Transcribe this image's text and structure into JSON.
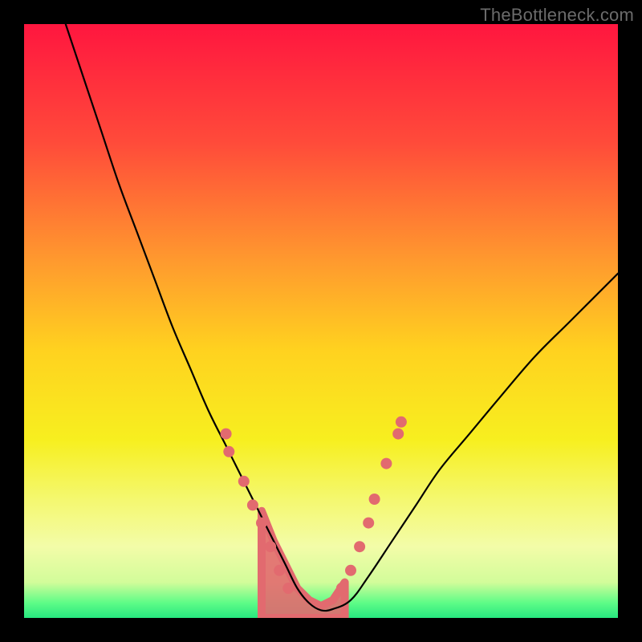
{
  "watermark": "TheBottleneck.com",
  "chart_data": {
    "type": "line",
    "title": "",
    "xlabel": "",
    "ylabel": "",
    "xlim": [
      0,
      100
    ],
    "ylim": [
      0,
      100
    ],
    "grid": false,
    "legend": false,
    "background_gradient": {
      "stops": [
        {
          "offset": 0.0,
          "color": "#ff163f"
        },
        {
          "offset": 0.2,
          "color": "#ff4b3a"
        },
        {
          "offset": 0.4,
          "color": "#ff9a2e"
        },
        {
          "offset": 0.55,
          "color": "#ffd21f"
        },
        {
          "offset": 0.7,
          "color": "#f7ef1f"
        },
        {
          "offset": 0.8,
          "color": "#f4f86f"
        },
        {
          "offset": 0.88,
          "color": "#f3fca8"
        },
        {
          "offset": 0.94,
          "color": "#d2fc9a"
        },
        {
          "offset": 0.975,
          "color": "#5dfc87"
        },
        {
          "offset": 1.0,
          "color": "#27e77f"
        }
      ]
    },
    "series": [
      {
        "name": "bottleneck-curve",
        "color": "#000000",
        "width": 2.2,
        "x": [
          7,
          10,
          13,
          16,
          19,
          22,
          25,
          28,
          31,
          34,
          36,
          38,
          40,
          42,
          44,
          46,
          48,
          50,
          52,
          55,
          58,
          62,
          66,
          70,
          75,
          80,
          86,
          92,
          100
        ],
        "y": [
          100,
          91,
          82,
          73,
          65,
          57,
          49,
          42,
          35,
          29,
          25,
          21,
          17,
          13,
          9,
          5,
          2.5,
          1.3,
          1.5,
          3,
          7,
          13,
          19,
          25,
          31,
          37,
          44,
          50,
          58
        ]
      },
      {
        "name": "sweet-spot-band",
        "type": "area",
        "color": "#e26a6f",
        "opacity": 0.9,
        "x": [
          40,
          42,
          44,
          46,
          48,
          50,
          52,
          54
        ],
        "y_top": [
          18,
          13,
          9,
          5,
          3,
          2,
          3,
          6
        ],
        "y_bottom": [
          0,
          0,
          0,
          0,
          0,
          0,
          0,
          0
        ]
      }
    ],
    "markers": [
      {
        "series": "left-dots",
        "color": "#e26a6f",
        "r": 7,
        "points": [
          {
            "x": 34.0,
            "y": 31
          },
          {
            "x": 34.5,
            "y": 28
          },
          {
            "x": 37.0,
            "y": 23
          },
          {
            "x": 38.5,
            "y": 19
          },
          {
            "x": 40.0,
            "y": 16
          },
          {
            "x": 41.5,
            "y": 12
          },
          {
            "x": 43.0,
            "y": 8
          },
          {
            "x": 44.5,
            "y": 5
          }
        ]
      },
      {
        "series": "right-dots",
        "color": "#e26a6f",
        "r": 7,
        "points": [
          {
            "x": 53.5,
            "y": 5
          },
          {
            "x": 55.0,
            "y": 8
          },
          {
            "x": 56.5,
            "y": 12
          },
          {
            "x": 58.0,
            "y": 16
          },
          {
            "x": 59.0,
            "y": 20
          },
          {
            "x": 61.0,
            "y": 26
          },
          {
            "x": 63.0,
            "y": 31
          },
          {
            "x": 63.5,
            "y": 33
          }
        ]
      }
    ]
  }
}
